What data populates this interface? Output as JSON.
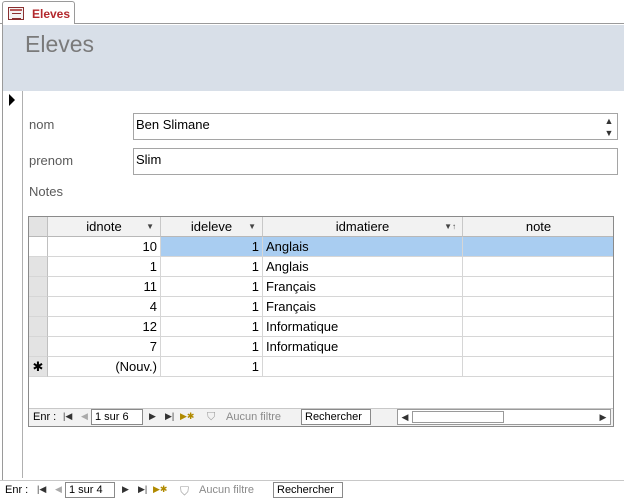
{
  "tab": {
    "label": "Eleves",
    "icon": "form-icon"
  },
  "header": {
    "title": "Eleves",
    "background": "#d8dfe8"
  },
  "form": {
    "nom": {
      "label": "nom",
      "value": "Ben Slimane"
    },
    "prenom": {
      "label": "prenom",
      "value": "Slim"
    },
    "notes_label": "Notes"
  },
  "subform": {
    "columns": [
      "idnote",
      "ideleve",
      "idmatiere",
      "note"
    ],
    "rows": [
      {
        "idnote": "10",
        "ideleve": "1",
        "idmatiere": "Anglais",
        "note": ""
      },
      {
        "idnote": "1",
        "ideleve": "1",
        "idmatiere": "Anglais",
        "note": ""
      },
      {
        "idnote": "11",
        "ideleve": "1",
        "idmatiere": "Français",
        "note": ""
      },
      {
        "idnote": "4",
        "ideleve": "1",
        "idmatiere": "Français",
        "note": ""
      },
      {
        "idnote": "12",
        "ideleve": "1",
        "idmatiere": "Informatique",
        "note": ""
      },
      {
        "idnote": "7",
        "ideleve": "1",
        "idmatiere": "Informatique",
        "note": ""
      }
    ],
    "new_row": {
      "marker": "✱",
      "idnote": "(Nouv.)",
      "ideleve": "1"
    },
    "nav": {
      "label": "Enr :",
      "record": "1 sur 6",
      "filter": "Aucun filtre",
      "search": "Rechercher"
    }
  },
  "main_nav": {
    "label": "Enr :",
    "record": "1 sur 4",
    "filter": "Aucun filtre",
    "search": "Rechercher"
  },
  "colors": {
    "title_text": "#7a7a7a",
    "tab_text": "#b3282d",
    "selected_row": "#a9cdf1"
  }
}
